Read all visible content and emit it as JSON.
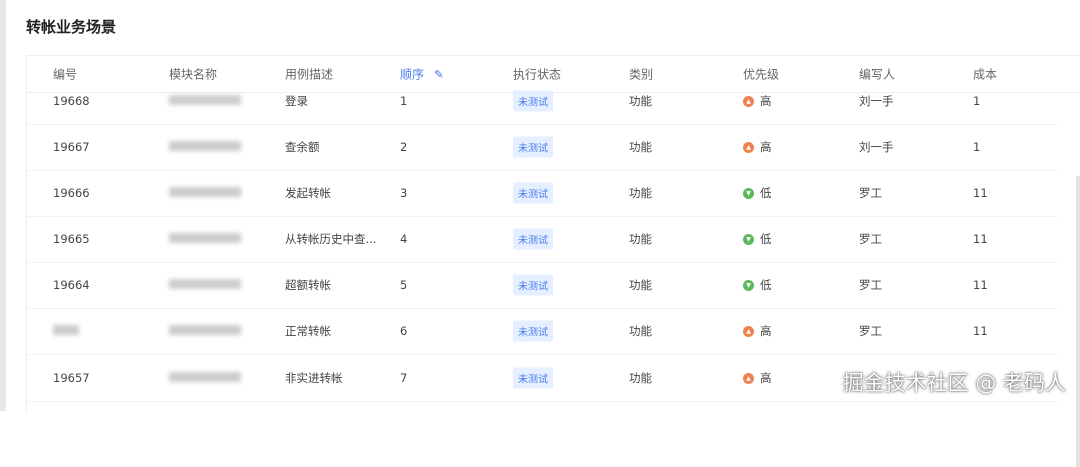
{
  "title": "转帐业务场景",
  "columns": [
    "编号",
    "模块名称",
    "用例描述",
    "顺序",
    "执行状态",
    "类别",
    "优先级",
    "编写人",
    "成本"
  ],
  "rows": [
    {
      "id": "19668",
      "desc": "登录",
      "order": "1",
      "status": "未测试",
      "type": "功能",
      "priority": "高",
      "author": "刘一手",
      "cost": "1"
    },
    {
      "id": "19667",
      "desc": "查余额",
      "order": "2",
      "status": "未测试",
      "type": "功能",
      "priority": "高",
      "author": "刘一手",
      "cost": "1"
    },
    {
      "id": "19666",
      "desc": "发起转帐",
      "order": "3",
      "status": "未测试",
      "type": "功能",
      "priority": "低",
      "author": "罗工",
      "cost": "11"
    },
    {
      "id": "19665",
      "desc": "从转帐历史中查...",
      "order": "4",
      "status": "未测试",
      "type": "功能",
      "priority": "低",
      "author": "罗工",
      "cost": "11"
    },
    {
      "id": "19664",
      "desc": "超额转帐",
      "order": "5",
      "status": "未测试",
      "type": "功能",
      "priority": "低",
      "author": "罗工",
      "cost": "11"
    },
    {
      "id": "",
      "desc": "正常转帐",
      "order": "6",
      "status": "未测试",
      "type": "功能",
      "priority": "高",
      "author": "罗工",
      "cost": "11"
    },
    {
      "id": "19657",
      "desc": "非实进转帐",
      "order": "7",
      "status": "未测试",
      "type": "功能",
      "priority": "高",
      "author": "",
      "cost": ""
    }
  ],
  "colors": {
    "high": "#f08150",
    "low": "#5cb85c",
    "accent": "#4a7cf0"
  },
  "watermark": "掘金技术社区 @ 老码人"
}
